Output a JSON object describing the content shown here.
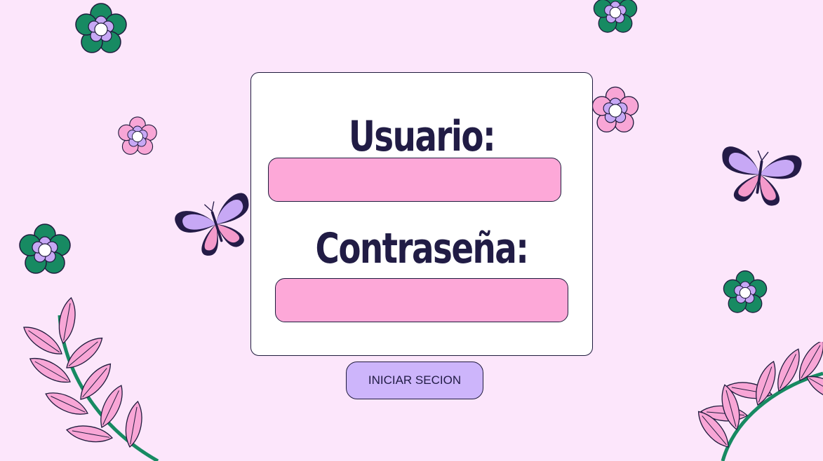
{
  "form": {
    "username_label": "Usuario:",
    "username_value": "",
    "password_label": "Contraseña:",
    "password_value": "",
    "submit_label": "INICIAR SECION"
  },
  "decorations": {
    "flowers": [
      "green-flower-icon",
      "pink-flower-icon"
    ],
    "butterflies": [
      "butterfly-icon"
    ],
    "branches": [
      "leaf-branch-icon"
    ]
  },
  "colors": {
    "background": "#fce6fb",
    "card": "#ffffff",
    "field": "#fda8d8",
    "button": "#cdb5fb",
    "text": "#211c45",
    "leaf_green": "#178a62",
    "flower_purple": "#c7a8f5",
    "flower_pink": "#f8a6d6"
  }
}
